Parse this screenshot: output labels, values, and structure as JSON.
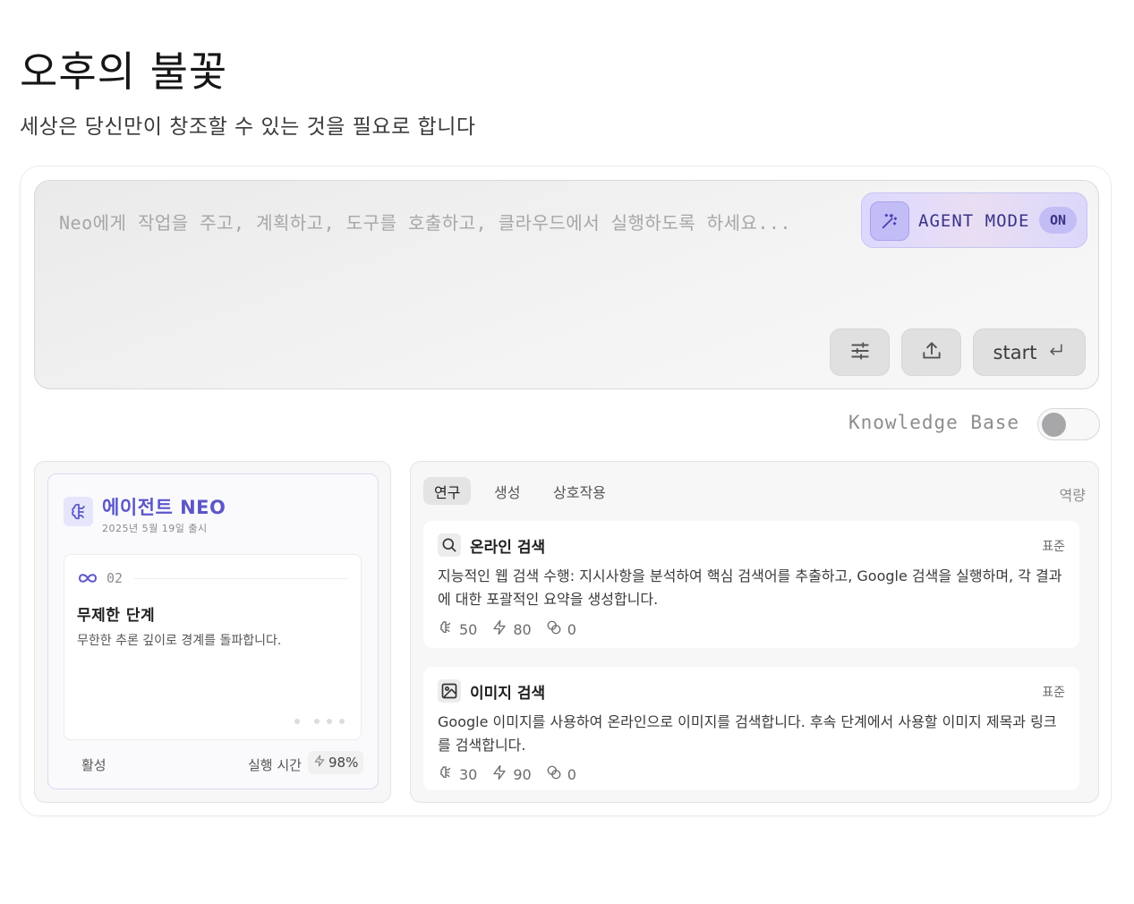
{
  "hero": {
    "title": "오후의 불꽃",
    "subtitle": "세상은 당신만이 창조할 수 있는 것을 필요로 합니다"
  },
  "prompt": {
    "placeholder": "Neo에게 작업을 주고, 계획하고, 도구를 호출하고, 클라우드에서 실행하도록 하세요...",
    "agent_mode_label": "AGENT MODE",
    "agent_mode_state": "ON",
    "settings_icon": "sliders-icon",
    "upload_icon": "upload-icon",
    "start_label": "start",
    "start_icon": "enter-icon"
  },
  "knowledge_base": {
    "label": "Knowledge Base",
    "enabled": false
  },
  "agent": {
    "name": "에이전트 NEO",
    "release_date": "2025년 5월 19일 출시",
    "step": {
      "number": "02",
      "title": "무제한 단계",
      "description": "무한한 추론 깊이로 경계를 돌파합니다."
    },
    "status": "활성",
    "runtime_label": "실행 시간",
    "runtime_value": "98%"
  },
  "capabilities": {
    "tabs": [
      "연구",
      "생성",
      "상호작용"
    ],
    "active_tab": "연구",
    "capacity_label": "역량",
    "tools": [
      {
        "icon": "search-icon",
        "title": "온라인 검색",
        "tag": "표준",
        "description": "지능적인 웹 검색 수행: 지시사항을 분석하여 핵심 검색어를 추출하고, Google 검색을 실행하며, 각 결과에 대한 포괄적인 요약을 생성합니다.",
        "stats": {
          "brain": "50",
          "speed": "80",
          "cost": "0"
        }
      },
      {
        "icon": "image-icon",
        "title": "이미지 검색",
        "tag": "표준",
        "description": "Google 이미지를 사용하여 온라인으로 이미지를 검색합니다. 후속 단계에서 사용할 이미지 제목과 링크를 검색합니다.",
        "stats": {
          "brain": "30",
          "speed": "90",
          "cost": "0"
        }
      }
    ]
  },
  "colors": {
    "accent": "#5c56c9",
    "agent_mode_bg": "#dcd8ff",
    "card_bg": "#f7f7f7"
  }
}
